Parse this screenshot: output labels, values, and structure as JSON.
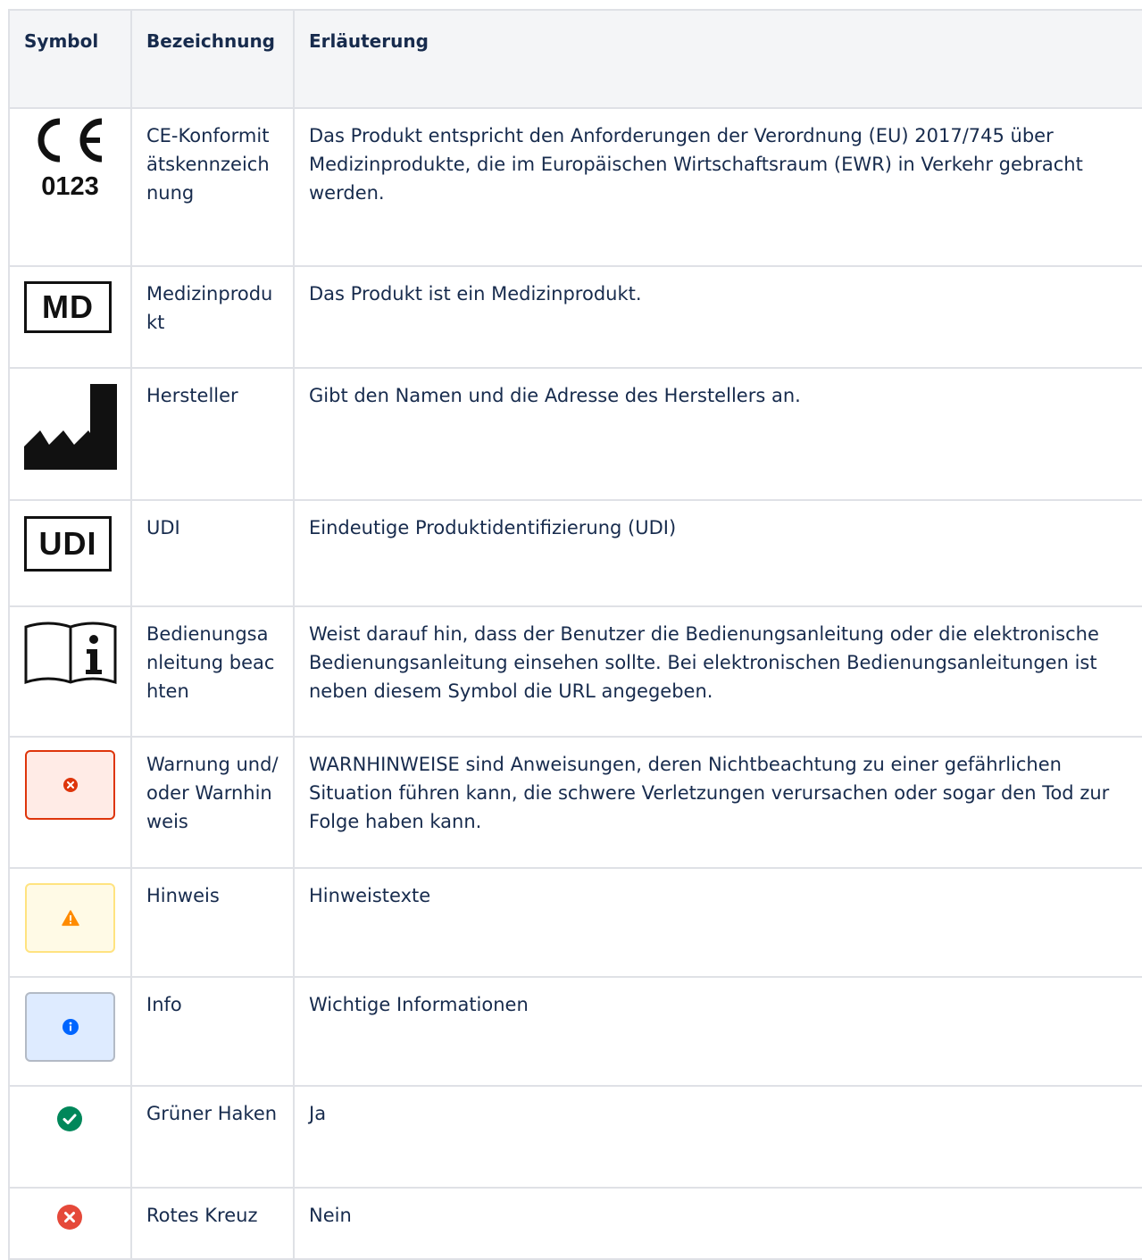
{
  "table": {
    "headers": [
      "Symbol",
      "Bezeichnung",
      "Erläuterung"
    ],
    "rows": [
      {
        "symbol_icon": "ce-marking-icon",
        "symbol_text": "0123",
        "name": "CE-Konformitätskennzeichnung",
        "description": "Das Produkt entspricht den Anforderungen der Verordnung (EU) 2017/745 über Medizinprodukte, die im Europäischen Wirtschaftsraum (EWR) in Verkehr gebracht werden."
      },
      {
        "symbol_icon": "medical-device-icon",
        "symbol_text": "MD",
        "name": "Medizinprodukt",
        "description": "Das Produkt ist ein Medizinprodukt."
      },
      {
        "symbol_icon": "manufacturer-icon",
        "name": "Hersteller",
        "description": "Gibt den Namen und die Adresse des Herstellers an."
      },
      {
        "symbol_icon": "udi-icon",
        "symbol_text": "UDI",
        "name": "UDI",
        "description": "Eindeutige Produktidentifizierung (UDI)"
      },
      {
        "symbol_icon": "instructions-for-use-icon",
        "name": "Bedienungsanleitung beachten",
        "description": "Weist darauf hin, dass der Benutzer die Bedienungsanleitung oder die elektronische Bedienungsanleitung einsehen sollte. Bei elektronischen Bedienungsanleitungen ist neben diesem Symbol die URL angegeben."
      },
      {
        "symbol_icon": "error-panel-icon",
        "name": "Warnung und/oder Warnhinweis",
        "description": "WARNHINWEISE sind Anweisungen, deren Nichtbeachtung zu einer gefährlichen Situation führen kann, die schwere Verletzungen verursachen oder sogar den Tod zur Folge haben kann."
      },
      {
        "symbol_icon": "warning-panel-icon",
        "name": "Hinweis",
        "description": "Hinweistexte"
      },
      {
        "symbol_icon": "info-panel-icon",
        "name": "Info",
        "description": "Wichtige Informationen"
      },
      {
        "symbol_icon": "green-check-icon",
        "name": "Grüner Haken",
        "description": "Ja"
      },
      {
        "symbol_icon": "red-cross-icon",
        "name": "Rotes Kreuz",
        "description": "Nein"
      }
    ]
  },
  "colors": {
    "header_bg": "#f4f5f7",
    "border": "#dfe1e6",
    "error_red": "#de350b",
    "warning_orange": "#ff8b00",
    "info_blue": "#0065ff",
    "success_green": "#00875a",
    "cross_red": "#e5493a"
  }
}
